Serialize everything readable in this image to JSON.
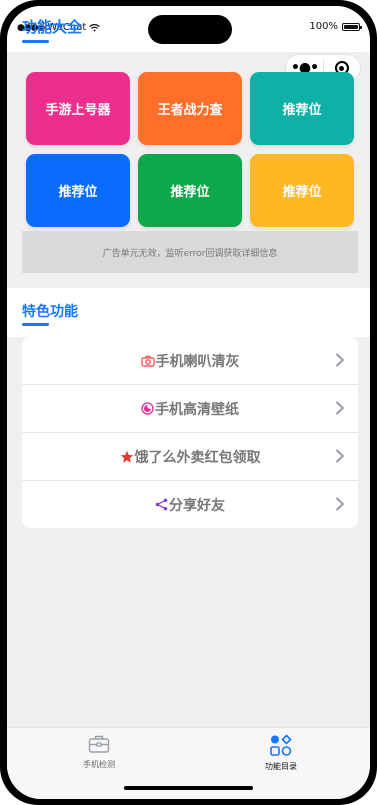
{
  "status": {
    "carrier": "WeChat",
    "battery_text": "100%"
  },
  "header": {
    "title": "功能大全"
  },
  "tiles": [
    {
      "label": "手游上号器",
      "color": "#ec2f8c"
    },
    {
      "label": "王者战力查",
      "color": "#ff6f2a"
    },
    {
      "label": "推荐位",
      "color": "#0db1a5"
    },
    {
      "label": "推荐位",
      "color": "#0a6cff"
    },
    {
      "label": "推荐位",
      "color": "#0ea84a"
    },
    {
      "label": "推荐位",
      "color": "#ffb722"
    }
  ],
  "ad_notice": "广告单元无效，监听error回调获取详细信息",
  "section": {
    "title": "特色功能"
  },
  "features": [
    {
      "label": "手机喇叭清灰",
      "icon": "camera-icon",
      "icon_color": "#ee4444"
    },
    {
      "label": "手机高清壁纸",
      "icon": "moon-icon",
      "icon_color": "#e0309a"
    },
    {
      "label": "饿了么外卖红包领取",
      "icon": "star-icon",
      "icon_color": "#e53935"
    },
    {
      "label": "分享好友",
      "icon": "share-icon",
      "icon_color": "#7b3fd1"
    }
  ],
  "tabbar": {
    "items": [
      {
        "label": "手机检测",
        "icon": "toolbox-icon",
        "active": false
      },
      {
        "label": "功能目录",
        "icon": "shapes-icon",
        "active": true
      }
    ]
  },
  "colors": {
    "accent": "#1677ff",
    "background": "#efefef",
    "text_muted": "#777777"
  }
}
